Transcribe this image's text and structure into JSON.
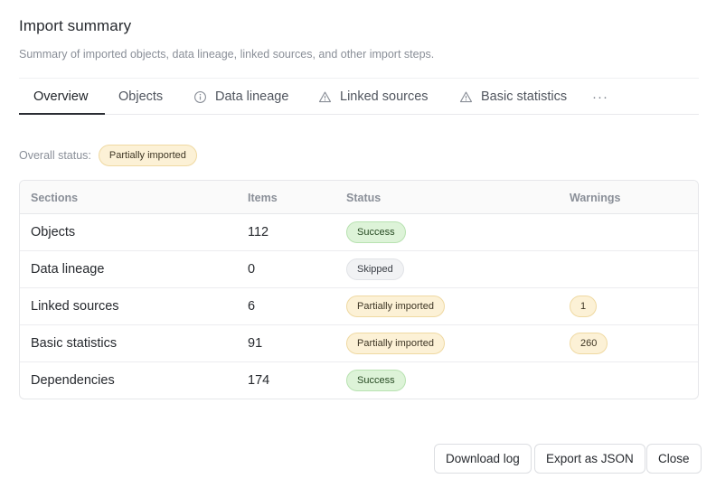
{
  "dialog": {
    "title": "Import summary",
    "subtitle": "Summary of imported objects, data lineage, linked sources, and other import steps."
  },
  "tabs": [
    {
      "label": "Overview",
      "icon": null,
      "active": true
    },
    {
      "label": "Objects",
      "icon": null,
      "active": false
    },
    {
      "label": "Data lineage",
      "icon": "info-icon",
      "active": false
    },
    {
      "label": "Linked sources",
      "icon": "warning-icon",
      "active": false
    },
    {
      "label": "Basic statistics",
      "icon": "warning-icon",
      "active": false
    }
  ],
  "more_label": "···",
  "overall": {
    "label": "Overall status:",
    "status": "Partially imported"
  },
  "table": {
    "headers": [
      "Sections",
      "Items",
      "Status",
      "Warnings"
    ],
    "rows": [
      {
        "section": "Objects",
        "items": "112",
        "status": "Success",
        "status_kind": "success",
        "warnings": ""
      },
      {
        "section": "Data lineage",
        "items": "0",
        "status": "Skipped",
        "status_kind": "skipped",
        "warnings": ""
      },
      {
        "section": "Linked sources",
        "items": "6",
        "status": "Partially imported",
        "status_kind": "partial",
        "warnings": "1"
      },
      {
        "section": "Basic statistics",
        "items": "91",
        "status": "Partially imported",
        "status_kind": "partial",
        "warnings": "260"
      },
      {
        "section": "Dependencies",
        "items": "174",
        "status": "Success",
        "status_kind": "success",
        "warnings": ""
      }
    ]
  },
  "footer": {
    "download_label": "Download log",
    "export_label": "Export as JSON",
    "close_label": "Close"
  },
  "colors": {
    "partial_bg": "#fcf1d6",
    "success_bg": "#ddf3d8",
    "skipped_bg": "#f1f2f4",
    "active_tab_underline": "#2a2d33"
  }
}
